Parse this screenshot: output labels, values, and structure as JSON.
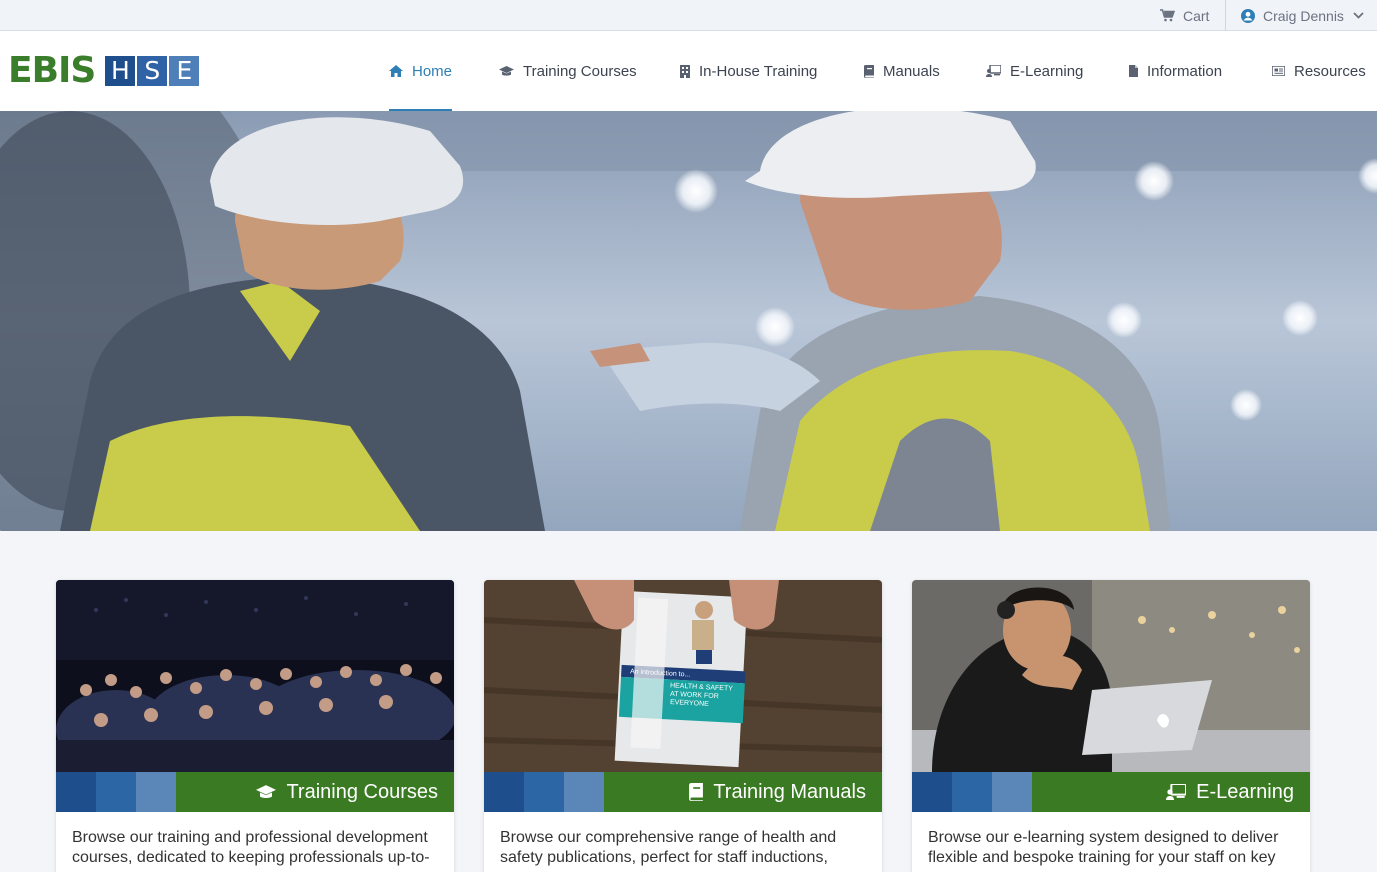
{
  "topbar": {
    "cart_label": "Cart",
    "user_name": "Craig Dennis"
  },
  "logo": {
    "ebis": "EBIS",
    "hse_letters": [
      "H",
      "S",
      "E"
    ],
    "hse_colors": [
      "#1f4e8c",
      "#2f63a6",
      "#4f7fb9"
    ]
  },
  "nav": {
    "items": [
      {
        "label": "Home",
        "icon": "home-icon",
        "active": true
      },
      {
        "label": "Training Courses",
        "icon": "graduation-cap-icon"
      },
      {
        "label": "In-House Training",
        "icon": "building-icon"
      },
      {
        "label": "Manuals",
        "icon": "book-icon"
      },
      {
        "label": "E-Learning",
        "icon": "laptop-user-icon"
      },
      {
        "label": "Information",
        "icon": "file-icon"
      },
      {
        "label": "Resources",
        "icon": "newspaper-icon"
      }
    ]
  },
  "colors": {
    "accent": "#2e7fb6",
    "brand_green": "#3a7a23",
    "band_blues": [
      "#1f4e8c",
      "#2c66a4",
      "#5b86b8"
    ]
  },
  "cards": [
    {
      "title": "Training Courses",
      "icon": "graduation-cap-icon",
      "text": "Browse our training and professional development courses, dedicated to keeping professionals up-to-"
    },
    {
      "title": "Training Manuals",
      "icon": "book-icon",
      "text": "Browse our comprehensive range of health and safety publications, perfect for staff inductions,"
    },
    {
      "title": "E-Learning",
      "icon": "laptop-user-icon",
      "text": "Browse our e-learning system designed to deliver flexible and bespoke training for your staff on key"
    }
  ],
  "manual_cover": {
    "line1": "HEALTH & SAFETY",
    "line2": "AT WORK FOR",
    "line3": "EVERYONE",
    "header": "An introduction to..."
  }
}
